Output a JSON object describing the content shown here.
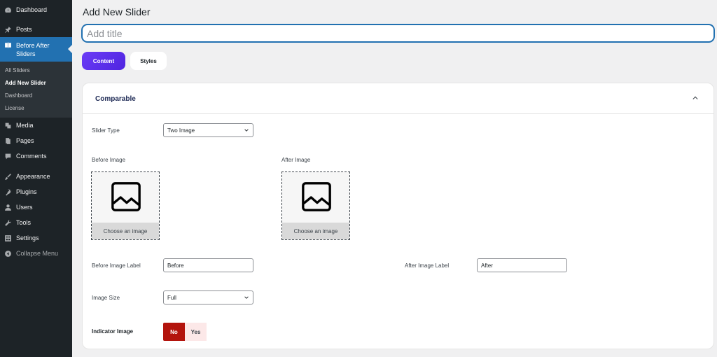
{
  "sidebar": {
    "dashboard": "Dashboard",
    "posts": "Posts",
    "before_after": "Before After Sliders",
    "submenu": [
      "All Sliders",
      "Add New Slider",
      "Dashboard",
      "License"
    ],
    "media": "Media",
    "pages": "Pages",
    "comments": "Comments",
    "appearance": "Appearance",
    "plugins": "Plugins",
    "users": "Users",
    "tools": "Tools",
    "settings": "Settings",
    "collapse": "Collapse Menu"
  },
  "page": {
    "title": "Add New Slider",
    "title_placeholder": "Add title"
  },
  "tabs": {
    "content": "Content",
    "styles": "Styles"
  },
  "panel": {
    "title": "Comparable",
    "slider_type_label": "Slider Type",
    "slider_type_value": "Two Image",
    "before_image_label": "Before Image",
    "after_image_label": "After Image",
    "choose_image": "Choose an image",
    "before_label_label": "Before Image Label",
    "before_label_value": "Before",
    "after_label_label": "After Image Label",
    "after_label_value": "After",
    "image_size_label": "Image Size",
    "image_size_value": "Full",
    "indicator_label": "Indicator Image",
    "indicator_no": "No",
    "indicator_yes": "Yes"
  },
  "colors": {
    "sidebar_bg": "#1d2327",
    "active_menu": "#2271b1",
    "tab_accent": "#5b2ff0",
    "toggle_no": "#b3140d"
  }
}
